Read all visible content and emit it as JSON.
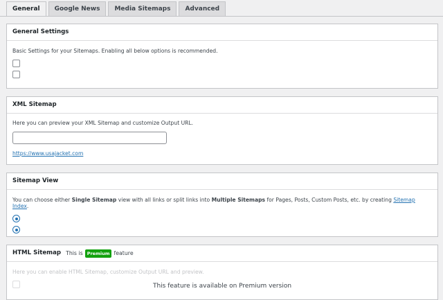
{
  "tabs": [
    {
      "label": "General",
      "active": true
    },
    {
      "label": "Google News",
      "active": false
    },
    {
      "label": "Media Sitemaps",
      "active": false
    },
    {
      "label": "Advanced",
      "active": false
    }
  ],
  "general": {
    "title": "General Settings",
    "description": "Basic Settings for your Sitemaps. Enabling all below options is recommended."
  },
  "xml": {
    "title": "XML Sitemap",
    "description": "Here you can preview your XML Sitemap and customize Output URL.",
    "input_value": "",
    "link": "https://www.usajacket.com"
  },
  "view": {
    "title": "Sitemap View",
    "desc_part1": "You can choose either ",
    "desc_bold1": "Single Sitemap",
    "desc_part2": " view with all links or split links into ",
    "desc_bold2": "Multiple Sitemaps",
    "desc_part3": " for Pages, Posts, Custom Posts, etc. by creating ",
    "desc_link": "Sitemap Index",
    "desc_end": "."
  },
  "html": {
    "title": "HTML Sitemap",
    "note_prefix": "This is",
    "badge": "Premium",
    "note_suffix": "feature",
    "description": "Here you can enable HTML Sitemap, customize Output URL and preview.",
    "premium_message": "This feature is available on Premium version"
  },
  "colors": {
    "accent": "#2271b1",
    "premium_badge": "#13a10e"
  }
}
